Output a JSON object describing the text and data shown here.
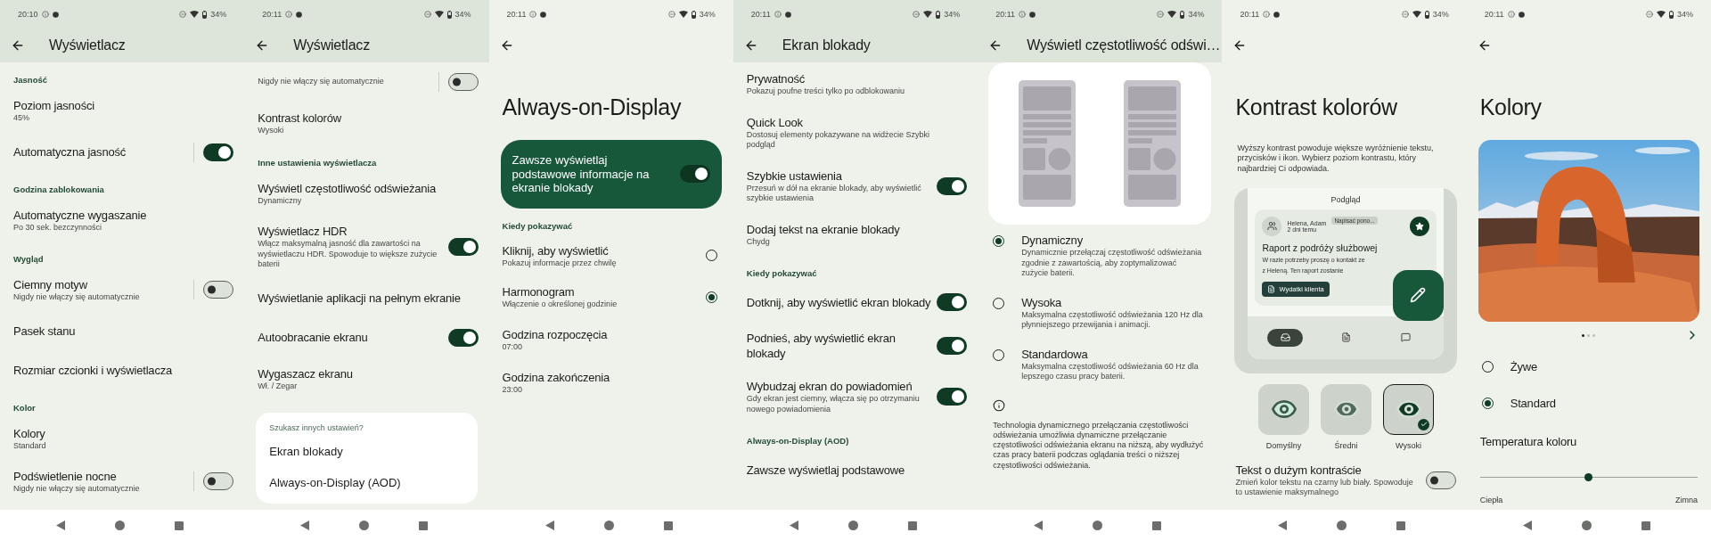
{
  "screens": [
    {
      "status": {
        "time": "20:10",
        "battery": "34%"
      },
      "app_bar": {
        "title": "Wyświetlacz",
        "raised": true
      },
      "content": [
        {
          "kind": "section",
          "text": "Jasność"
        },
        {
          "kind": "pref",
          "title": "Poziom jasności",
          "summary": "45%"
        },
        {
          "kind": "pref",
          "title": "Automatyczna jasność",
          "on": true,
          "divider": true
        },
        {
          "kind": "section",
          "text": "Godzina zablokowania"
        },
        {
          "kind": "pref",
          "title": "Automatyczne wygaszanie",
          "summary": "Po 30 sek. bezczynności"
        },
        {
          "kind": "section",
          "text": "Wygląd"
        },
        {
          "kind": "pref",
          "title": "Ciemny motyw",
          "summary": "Nigdy nie włączy się automatycznie",
          "on": false,
          "divider": true
        },
        {
          "kind": "pref",
          "title": "Pasek stanu"
        },
        {
          "kind": "pref",
          "title": "Rozmiar czcionki i wyświetlacza"
        },
        {
          "kind": "section",
          "text": "Kolor"
        },
        {
          "kind": "pref",
          "title": "Kolory",
          "summary": "Standard"
        },
        {
          "kind": "pref",
          "title": "Podświetlenie nocne",
          "summary": "Nigdy nie włączy się automatycznie",
          "on": false,
          "divider": true
        }
      ]
    },
    {
      "status": {
        "time": "20:11",
        "battery": "34%"
      },
      "app_bar": {
        "title": "Wyświetlacz",
        "raised": true
      },
      "content": [
        {
          "kind": "pref",
          "summary": "Nigdy nie włączy się automatycznie",
          "on": false,
          "divider": true
        },
        {
          "kind": "pref",
          "title": "Kontrast kolorów",
          "summary": "Wysoki"
        },
        {
          "kind": "section",
          "text": "Inne ustawienia wyświetlacza"
        },
        {
          "kind": "pref",
          "title": "Wyświetl częstotliwość odświeżania",
          "summary": "Dynamiczny"
        },
        {
          "kind": "pref",
          "title": "Wyświetlacz HDR",
          "summary": "Włącz maksymalną jasność dla zawartości na wyświetlaczu HDR. Spowoduje to większe zużycie baterii",
          "on": true
        },
        {
          "kind": "pref",
          "title": "Wyświetlanie aplikacji na pełnym ekranie"
        },
        {
          "kind": "pref",
          "title": "Autoobracanie ekranu",
          "on": true
        },
        {
          "kind": "pref",
          "title": "Wygaszacz ekranu",
          "summary": "Wł. / Zegar"
        },
        {
          "kind": "suggest",
          "heading": "Szukasz innych ustawień?",
          "links": [
            "Ekran blokady",
            "Always-on-Display (AOD)"
          ]
        }
      ]
    },
    {
      "status": {
        "time": "20:11",
        "battery": "34%"
      },
      "app_bar": {
        "raised": false
      },
      "content": [
        {
          "kind": "big_title",
          "text": "Always-on-Display"
        },
        {
          "kind": "main_switch",
          "text": "Zawsze wyświetlaj podstawowe informacje na ekranie blokady",
          "on": true
        },
        {
          "kind": "section",
          "text": "Kiedy pokazywać"
        },
        {
          "kind": "option",
          "title": "Kliknij, aby wyświetlić",
          "summary": "Pokazuj informacje przez chwilę",
          "selected": false
        },
        {
          "kind": "option",
          "title": "Harmonogram",
          "summary": "Włączenie o określonej godzinie",
          "selected": true
        },
        {
          "kind": "pref",
          "title": "Godzina rozpoczęcia",
          "summary": "07:00"
        },
        {
          "kind": "pref",
          "title": "Godzina zakończenia",
          "summary": "23:00"
        }
      ]
    },
    {
      "status": {
        "time": "20:11",
        "battery": "34%"
      },
      "app_bar": {
        "title": "Ekran blokady",
        "raised": true
      },
      "content": [
        {
          "kind": "pref",
          "title": "Prywatność",
          "summary": "Pokazuj poufne treści tylko po odblokowaniu"
        },
        {
          "kind": "pref",
          "title": "Quick Look",
          "summary": "Dostosuj elementy pokazywane na widżecie Szybki podgląd"
        },
        {
          "kind": "pref",
          "title": "Szybkie ustawienia",
          "summary": "Przesuń w dół na ekranie blokady, aby wyświetlić szybkie ustawienia",
          "on": true
        },
        {
          "kind": "pref",
          "title": "Dodaj tekst na ekranie blokady",
          "summary": "Chydg"
        },
        {
          "kind": "section",
          "text": "Kiedy pokazywać"
        },
        {
          "kind": "pref",
          "title": "Dotknij, aby wyświetlić ekran blokady",
          "on": true
        },
        {
          "kind": "pref",
          "title": "Podnieś, aby wyświetlić ekran blokady",
          "on": true
        },
        {
          "kind": "pref",
          "title": "Wybudzaj ekran do powiadomień",
          "summary": "Gdy ekran jest ciemny, włącza się po otrzymaniu nowego powiadomienia",
          "on": true
        },
        {
          "kind": "section",
          "text": "Always-on-Display (AOD)"
        },
        {
          "kind": "pref",
          "title": "Zawsze wyświetlaj podstawowe"
        }
      ]
    },
    {
      "status": {
        "time": "20:11",
        "battery": "34%"
      },
      "app_bar": {
        "title": "Wyświetl częstotliwość odświ…",
        "raised": true
      },
      "content": [
        {
          "kind": "refresh_illustration"
        },
        {
          "kind": "radio",
          "title": "Dynamiczny",
          "summary": "Dynamicznie przełączaj częstotliwość odświeżania zgodnie z zawartością, aby zoptymalizować zużycie baterii.",
          "selected": true
        },
        {
          "kind": "radio",
          "title": "Wysoka",
          "summary": "Maksymalna częstotliwość odświeżania 120 Hz dla płynniejszego przewijania i animacji.",
          "selected": false
        },
        {
          "kind": "radio",
          "title": "Standardowa",
          "summary": "Maksymalna częstotliwość odświeżania 60 Hz dla lepszego czasu pracy baterii.",
          "selected": false
        },
        {
          "kind": "info_icon"
        },
        {
          "kind": "paragraph",
          "text": "Technologia dynamicznego przełączania częstotliwości odświeżania umożliwia dynamiczne przełączanie częstotliwości odświeżania ekranu na niższą, aby wydłużyć czas pracy baterii podczas oglądania treści o niższej częstotliwości odświeżania."
        }
      ]
    },
    {
      "status": {
        "time": "20:11",
        "battery": "34%"
      },
      "app_bar": {
        "raised": false
      },
      "content": [
        {
          "kind": "big_title",
          "text": "Kontrast kolorów"
        },
        {
          "kind": "paragraph",
          "text": "Wyższy kontrast powoduje większe wyróżnienie tekstu, przycisków i ikon. Wybierz poziom kontrastu, który najbardziej Ci odpowiada."
        },
        {
          "kind": "contrast_preview",
          "heading": "Podgląd",
          "sender": "Helena, Adam",
          "chip": "Napisać pono...",
          "time": "2 dni temu",
          "subject": "Raport z podróży służbowej",
          "body_lines": [
            "W razie potrzeby proszę o kontakt ze",
            "z Heleną. Ten raport zostanie"
          ],
          "button": "Wydatki klienta",
          "tabs": [
            {
              "selected": true
            },
            {
              "selected": false
            },
            {
              "selected": false
            }
          ]
        },
        {
          "kind": "contrast_levels",
          "options": [
            {
              "label": "Domyślny",
              "selected": false
            },
            {
              "label": "Średni",
              "selected": false
            },
            {
              "label": "Wysoki",
              "selected": true
            }
          ]
        },
        {
          "kind": "pref",
          "title": "Tekst o dużym kontraście",
          "summary": "Zmień kolor tekstu na czarny lub biały. Spowoduje to ustawienie maksymalnego",
          "on": false
        }
      ]
    },
    {
      "status": {
        "time": "20:11",
        "battery": "34%"
      },
      "app_bar": {
        "raised": false
      },
      "content": [
        {
          "kind": "big_title",
          "text": "Kolory"
        },
        {
          "kind": "picture"
        },
        {
          "kind": "pager",
          "dots": [
            {
              "selected": true
            },
            {
              "selected": false
            },
            {
              "selected": false
            }
          ]
        },
        {
          "kind": "radio",
          "title": "Żywe",
          "selected": false
        },
        {
          "kind": "radio",
          "title": "Standard",
          "selected": true
        },
        {
          "kind": "pref",
          "title": "Temperatura koloru"
        },
        {
          "kind": "slider",
          "level": 0.5,
          "min_label": "Ciepła",
          "max_label": "Zimna"
        }
      ]
    }
  ]
}
